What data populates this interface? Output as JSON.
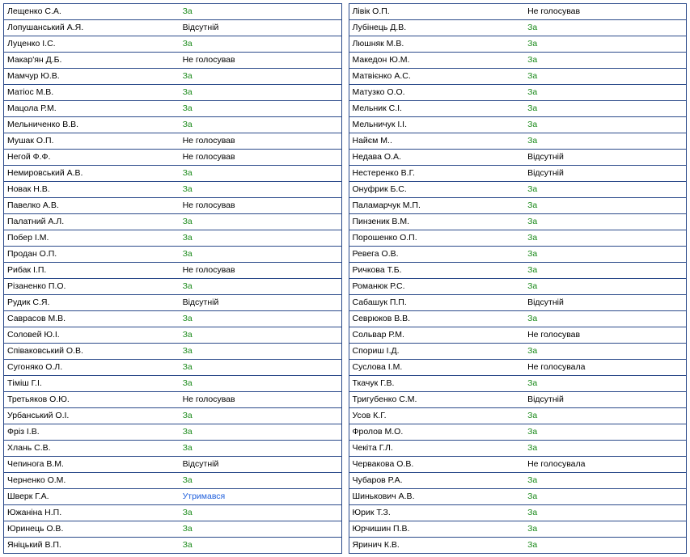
{
  "left": [
    {
      "name": "Лещенко С.А.",
      "vote": "За",
      "cls": "v-za"
    },
    {
      "name": "Лопушанський А.Я.",
      "vote": "Відсутній",
      "cls": ""
    },
    {
      "name": "Луценко І.С.",
      "vote": "За",
      "cls": "v-za"
    },
    {
      "name": "Макар'ян Д.Б.",
      "vote": "Не голосував",
      "cls": ""
    },
    {
      "name": "Мамчур Ю.В.",
      "vote": "За",
      "cls": "v-za"
    },
    {
      "name": "Матіос М.В.",
      "vote": "За",
      "cls": "v-za"
    },
    {
      "name": "Мацола Р.М.",
      "vote": "За",
      "cls": "v-za"
    },
    {
      "name": "Мельниченко В.В.",
      "vote": "За",
      "cls": "v-za"
    },
    {
      "name": "Мушак О.П.",
      "vote": "Не голосував",
      "cls": ""
    },
    {
      "name": "Негой Ф.Ф.",
      "vote": "Не голосував",
      "cls": ""
    },
    {
      "name": "Немировський А.В.",
      "vote": "За",
      "cls": "v-za"
    },
    {
      "name": "Новак Н.В.",
      "vote": "За",
      "cls": "v-za"
    },
    {
      "name": "Павелко А.В.",
      "vote": "Не голосував",
      "cls": ""
    },
    {
      "name": "Палатний А.Л.",
      "vote": "За",
      "cls": "v-za"
    },
    {
      "name": "Побер І.М.",
      "vote": "За",
      "cls": "v-za"
    },
    {
      "name": "Продан О.П.",
      "vote": "За",
      "cls": "v-za"
    },
    {
      "name": "Рибак І.П.",
      "vote": "Не голосував",
      "cls": ""
    },
    {
      "name": "Різаненко П.О.",
      "vote": "За",
      "cls": "v-za"
    },
    {
      "name": "Рудик С.Я.",
      "vote": "Відсутній",
      "cls": ""
    },
    {
      "name": "Саврасов М.В.",
      "vote": "За",
      "cls": "v-za"
    },
    {
      "name": "Соловей Ю.І.",
      "vote": "За",
      "cls": "v-za"
    },
    {
      "name": "Співаковський О.В.",
      "vote": "За",
      "cls": "v-za"
    },
    {
      "name": "Сугоняко О.Л.",
      "vote": "За",
      "cls": "v-za"
    },
    {
      "name": "Тіміш Г.І.",
      "vote": "За",
      "cls": "v-za"
    },
    {
      "name": "Третьяков О.Ю.",
      "vote": "Не голосував",
      "cls": ""
    },
    {
      "name": "Урбанський О.І.",
      "vote": "За",
      "cls": "v-za"
    },
    {
      "name": "Фріз І.В.",
      "vote": "За",
      "cls": "v-za"
    },
    {
      "name": "Хлань С.В.",
      "vote": "За",
      "cls": "v-za"
    },
    {
      "name": "Чепинога В.М.",
      "vote": "Відсутній",
      "cls": ""
    },
    {
      "name": "Черненко О.М.",
      "vote": "За",
      "cls": "v-za"
    },
    {
      "name": "Шверк Г.А.",
      "vote": "Утримався",
      "cls": "v-abstain"
    },
    {
      "name": "Южаніна Н.П.",
      "vote": "За",
      "cls": "v-za"
    },
    {
      "name": "Юринець О.В.",
      "vote": "За",
      "cls": "v-za"
    },
    {
      "name": "Яніцький В.П.",
      "vote": "За",
      "cls": "v-za"
    }
  ],
  "right": [
    {
      "name": "Лівік О.П.",
      "vote": "Не голосував",
      "cls": ""
    },
    {
      "name": "Лубінець Д.В.",
      "vote": "За",
      "cls": "v-za"
    },
    {
      "name": "Люшняк М.В.",
      "vote": "За",
      "cls": "v-za"
    },
    {
      "name": "Македон Ю.М.",
      "vote": "За",
      "cls": "v-za"
    },
    {
      "name": "Матвієнко А.С.",
      "vote": "За",
      "cls": "v-za"
    },
    {
      "name": "Матузко О.О.",
      "vote": "За",
      "cls": "v-za"
    },
    {
      "name": "Мельник С.І.",
      "vote": "За",
      "cls": "v-za"
    },
    {
      "name": "Мельничук І.І.",
      "vote": "За",
      "cls": "v-za"
    },
    {
      "name": "Найєм М..",
      "vote": "За",
      "cls": "v-za"
    },
    {
      "name": "Недава О.А.",
      "vote": "Відсутній",
      "cls": ""
    },
    {
      "name": "Нестеренко В.Г.",
      "vote": "Відсутній",
      "cls": ""
    },
    {
      "name": "Онуфрик Б.С.",
      "vote": "За",
      "cls": "v-za"
    },
    {
      "name": "Паламарчук М.П.",
      "vote": "За",
      "cls": "v-za"
    },
    {
      "name": "Пинзеник В.М.",
      "vote": "За",
      "cls": "v-za"
    },
    {
      "name": "Порошенко О.П.",
      "vote": "За",
      "cls": "v-za"
    },
    {
      "name": "Ревега О.В.",
      "vote": "За",
      "cls": "v-za"
    },
    {
      "name": "Ричкова Т.Б.",
      "vote": "За",
      "cls": "v-za"
    },
    {
      "name": "Романюк Р.С.",
      "vote": "За",
      "cls": "v-za"
    },
    {
      "name": "Сабашук П.П.",
      "vote": "Відсутній",
      "cls": ""
    },
    {
      "name": "Севрюков В.В.",
      "vote": "За",
      "cls": "v-za"
    },
    {
      "name": "Сольвар Р.М.",
      "vote": "Не голосував",
      "cls": ""
    },
    {
      "name": "Спориш І.Д.",
      "vote": "За",
      "cls": "v-za"
    },
    {
      "name": "Суслова І.М.",
      "vote": "Не голосувала",
      "cls": ""
    },
    {
      "name": "Ткачук Г.В.",
      "vote": "За",
      "cls": "v-za"
    },
    {
      "name": "Тригубенко С.М.",
      "vote": "Відсутній",
      "cls": ""
    },
    {
      "name": "Усов К.Г.",
      "vote": "За",
      "cls": "v-za"
    },
    {
      "name": "Фролов М.О.",
      "vote": "За",
      "cls": "v-za"
    },
    {
      "name": "Чекіта Г.Л.",
      "vote": "За",
      "cls": "v-za"
    },
    {
      "name": "Червакова О.В.",
      "vote": "Не голосувала",
      "cls": ""
    },
    {
      "name": "Чубаров Р.А.",
      "vote": "За",
      "cls": "v-za"
    },
    {
      "name": "Шинькович А.В.",
      "vote": "За",
      "cls": "v-za"
    },
    {
      "name": "Юрик Т.З.",
      "vote": "За",
      "cls": "v-za"
    },
    {
      "name": "Юрчишин П.В.",
      "vote": "За",
      "cls": "v-za"
    },
    {
      "name": "Яринич К.В.",
      "vote": "За",
      "cls": "v-za"
    }
  ]
}
